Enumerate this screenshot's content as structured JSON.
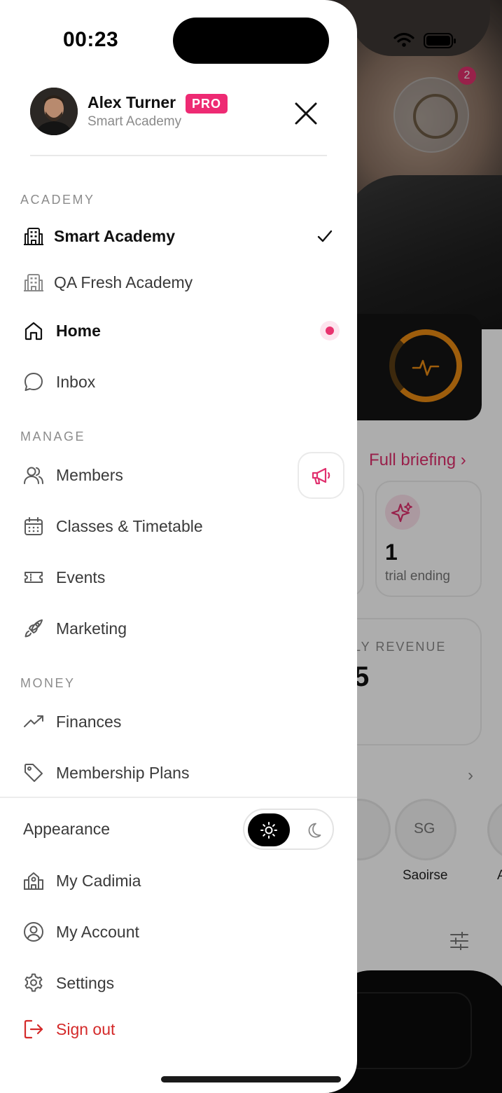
{
  "status_bar": {
    "time": "00:23"
  },
  "background": {
    "notification_count": "2",
    "full_briefing": "Full briefing",
    "trial_count": "1",
    "trial_label": "trial ending",
    "revenue_label": "LY REVENUE",
    "revenue_value": "5",
    "member_initials": "SG",
    "member_name": "Saoirse",
    "member_name_2": "A"
  },
  "drawer": {
    "user": {
      "name": "Alex Turner",
      "badge": "PRO",
      "academy": "Smart Academy"
    },
    "sections": {
      "academy": "ACADEMY",
      "manage": "MANAGE",
      "money": "MONEY"
    },
    "academies": [
      {
        "label": "Smart Academy",
        "selected": true
      },
      {
        "label": "QA Fresh Academy",
        "selected": false
      }
    ],
    "primary": [
      {
        "label": "Home",
        "icon": "home-icon",
        "active": true
      },
      {
        "label": "Inbox",
        "icon": "chat-bubble-icon",
        "active": false
      }
    ],
    "manage_items": [
      {
        "label": "Members",
        "icon": "users-icon"
      },
      {
        "label": "Classes & Timetable",
        "icon": "calendar-icon"
      },
      {
        "label": "Events",
        "icon": "ticket-icon"
      },
      {
        "label": "Marketing",
        "icon": "rocket-icon"
      }
    ],
    "money_items": [
      {
        "label": "Finances",
        "icon": "trending-up-icon"
      },
      {
        "label": "Membership Plans",
        "icon": "tag-icon"
      }
    ],
    "appearance": {
      "label": "Appearance",
      "mode": "light"
    },
    "footer_items": [
      {
        "label": "My Cadimia",
        "icon": "school-building-icon"
      },
      {
        "label": "My Account",
        "icon": "user-circle-icon"
      },
      {
        "label": "Settings",
        "icon": "gear-icon"
      }
    ],
    "sign_out": "Sign out",
    "colors": {
      "accent": "#ee2a73",
      "danger": "#d42a2a",
      "ring": "#e78a12"
    }
  }
}
